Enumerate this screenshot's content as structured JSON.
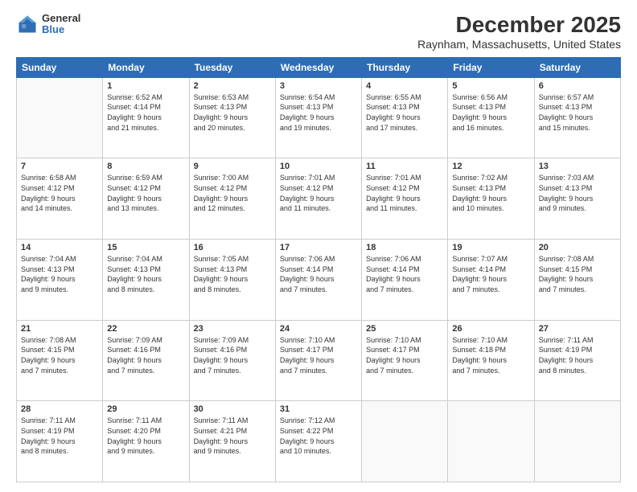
{
  "logo": {
    "general": "General",
    "blue": "Blue"
  },
  "title": "December 2025",
  "subtitle": "Raynham, Massachusetts, United States",
  "days_of_week": [
    "Sunday",
    "Monday",
    "Tuesday",
    "Wednesday",
    "Thursday",
    "Friday",
    "Saturday"
  ],
  "weeks": [
    [
      {
        "day": "",
        "info": ""
      },
      {
        "day": "1",
        "info": "Sunrise: 6:52 AM\nSunset: 4:14 PM\nDaylight: 9 hours\nand 21 minutes."
      },
      {
        "day": "2",
        "info": "Sunrise: 6:53 AM\nSunset: 4:13 PM\nDaylight: 9 hours\nand 20 minutes."
      },
      {
        "day": "3",
        "info": "Sunrise: 6:54 AM\nSunset: 4:13 PM\nDaylight: 9 hours\nand 19 minutes."
      },
      {
        "day": "4",
        "info": "Sunrise: 6:55 AM\nSunset: 4:13 PM\nDaylight: 9 hours\nand 17 minutes."
      },
      {
        "day": "5",
        "info": "Sunrise: 6:56 AM\nSunset: 4:13 PM\nDaylight: 9 hours\nand 16 minutes."
      },
      {
        "day": "6",
        "info": "Sunrise: 6:57 AM\nSunset: 4:13 PM\nDaylight: 9 hours\nand 15 minutes."
      }
    ],
    [
      {
        "day": "7",
        "info": "Sunrise: 6:58 AM\nSunset: 4:12 PM\nDaylight: 9 hours\nand 14 minutes."
      },
      {
        "day": "8",
        "info": "Sunrise: 6:59 AM\nSunset: 4:12 PM\nDaylight: 9 hours\nand 13 minutes."
      },
      {
        "day": "9",
        "info": "Sunrise: 7:00 AM\nSunset: 4:12 PM\nDaylight: 9 hours\nand 12 minutes."
      },
      {
        "day": "10",
        "info": "Sunrise: 7:01 AM\nSunset: 4:12 PM\nDaylight: 9 hours\nand 11 minutes."
      },
      {
        "day": "11",
        "info": "Sunrise: 7:01 AM\nSunset: 4:12 PM\nDaylight: 9 hours\nand 11 minutes."
      },
      {
        "day": "12",
        "info": "Sunrise: 7:02 AM\nSunset: 4:13 PM\nDaylight: 9 hours\nand 10 minutes."
      },
      {
        "day": "13",
        "info": "Sunrise: 7:03 AM\nSunset: 4:13 PM\nDaylight: 9 hours\nand 9 minutes."
      }
    ],
    [
      {
        "day": "14",
        "info": "Sunrise: 7:04 AM\nSunset: 4:13 PM\nDaylight: 9 hours\nand 9 minutes."
      },
      {
        "day": "15",
        "info": "Sunrise: 7:04 AM\nSunset: 4:13 PM\nDaylight: 9 hours\nand 8 minutes."
      },
      {
        "day": "16",
        "info": "Sunrise: 7:05 AM\nSunset: 4:13 PM\nDaylight: 9 hours\nand 8 minutes."
      },
      {
        "day": "17",
        "info": "Sunrise: 7:06 AM\nSunset: 4:14 PM\nDaylight: 9 hours\nand 7 minutes."
      },
      {
        "day": "18",
        "info": "Sunrise: 7:06 AM\nSunset: 4:14 PM\nDaylight: 9 hours\nand 7 minutes."
      },
      {
        "day": "19",
        "info": "Sunrise: 7:07 AM\nSunset: 4:14 PM\nDaylight: 9 hours\nand 7 minutes."
      },
      {
        "day": "20",
        "info": "Sunrise: 7:08 AM\nSunset: 4:15 PM\nDaylight: 9 hours\nand 7 minutes."
      }
    ],
    [
      {
        "day": "21",
        "info": "Sunrise: 7:08 AM\nSunset: 4:15 PM\nDaylight: 9 hours\nand 7 minutes."
      },
      {
        "day": "22",
        "info": "Sunrise: 7:09 AM\nSunset: 4:16 PM\nDaylight: 9 hours\nand 7 minutes."
      },
      {
        "day": "23",
        "info": "Sunrise: 7:09 AM\nSunset: 4:16 PM\nDaylight: 9 hours\nand 7 minutes."
      },
      {
        "day": "24",
        "info": "Sunrise: 7:10 AM\nSunset: 4:17 PM\nDaylight: 9 hours\nand 7 minutes."
      },
      {
        "day": "25",
        "info": "Sunrise: 7:10 AM\nSunset: 4:17 PM\nDaylight: 9 hours\nand 7 minutes."
      },
      {
        "day": "26",
        "info": "Sunrise: 7:10 AM\nSunset: 4:18 PM\nDaylight: 9 hours\nand 7 minutes."
      },
      {
        "day": "27",
        "info": "Sunrise: 7:11 AM\nSunset: 4:19 PM\nDaylight: 9 hours\nand 8 minutes."
      }
    ],
    [
      {
        "day": "28",
        "info": "Sunrise: 7:11 AM\nSunset: 4:19 PM\nDaylight: 9 hours\nand 8 minutes."
      },
      {
        "day": "29",
        "info": "Sunrise: 7:11 AM\nSunset: 4:20 PM\nDaylight: 9 hours\nand 9 minutes."
      },
      {
        "day": "30",
        "info": "Sunrise: 7:11 AM\nSunset: 4:21 PM\nDaylight: 9 hours\nand 9 minutes."
      },
      {
        "day": "31",
        "info": "Sunrise: 7:12 AM\nSunset: 4:22 PM\nDaylight: 9 hours\nand 10 minutes."
      },
      {
        "day": "",
        "info": ""
      },
      {
        "day": "",
        "info": ""
      },
      {
        "day": "",
        "info": ""
      }
    ]
  ]
}
